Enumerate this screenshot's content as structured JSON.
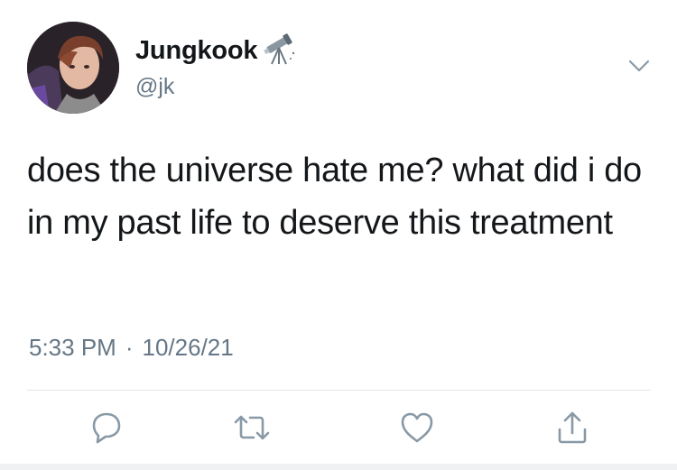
{
  "tweet": {
    "author": {
      "display_name": "Jungkook",
      "emoji": "telescope-icon",
      "handle": "@jk"
    },
    "text": "does the universe hate me? what did i do in my past life to deserve this treatment",
    "time": "5:33 PM",
    "separator": "·",
    "date": "10/26/21"
  },
  "actions": [
    "reply-icon",
    "retweet-icon",
    "like-icon",
    "share-icon"
  ],
  "colors": {
    "text": "#14171a",
    "secondary": "#657786",
    "divider": "#dfe3e7"
  }
}
